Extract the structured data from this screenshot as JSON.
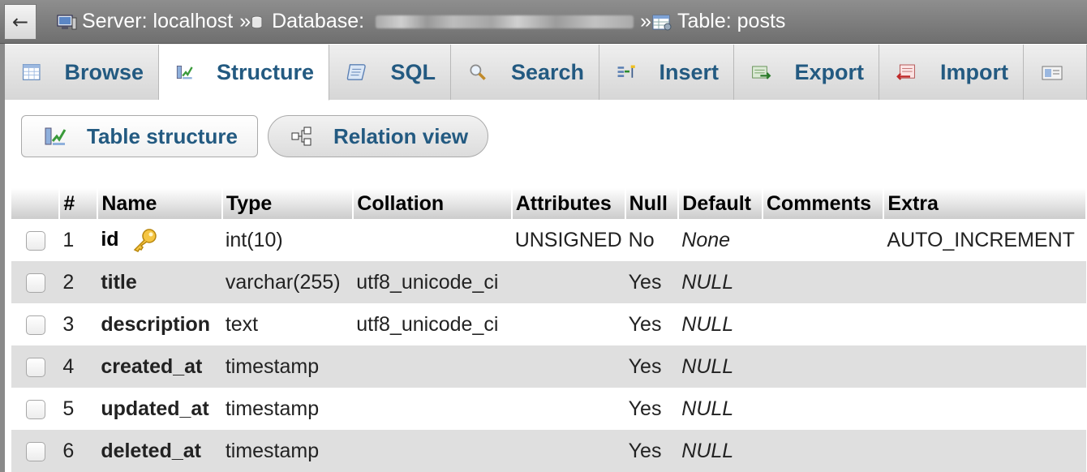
{
  "breadcrumb": {
    "back_icon": "←",
    "server": "Server: localhost",
    "database": "Database:",
    "table": "Table: posts",
    "separator": "»"
  },
  "tabs": [
    {
      "label": "Browse",
      "icon": "browse-icon"
    },
    {
      "label": "Structure",
      "icon": "structure-icon",
      "active": true
    },
    {
      "label": "SQL",
      "icon": "sql-icon"
    },
    {
      "label": "Search",
      "icon": "search-icon"
    },
    {
      "label": "Insert",
      "icon": "insert-icon"
    },
    {
      "label": "Export",
      "icon": "export-icon"
    },
    {
      "label": "Import",
      "icon": "import-icon"
    }
  ],
  "subviews": {
    "table_structure": "Table structure",
    "relation_view": "Relation view"
  },
  "columns": {
    "num": "#",
    "name": "Name",
    "type": "Type",
    "collation": "Collation",
    "attributes": "Attributes",
    "null": "Null",
    "default": "Default",
    "comments": "Comments",
    "extra": "Extra"
  },
  "rows": [
    {
      "num": "1",
      "name": "id",
      "type": "int(10)",
      "collation": "",
      "attributes": "UNSIGNED",
      "null": "No",
      "default": "None",
      "comments": "",
      "extra": "AUTO_INCREMENT"
    },
    {
      "num": "2",
      "name": "title",
      "type": "varchar(255)",
      "collation": "utf8_unicode_ci",
      "attributes": "",
      "null": "Yes",
      "default": "NULL",
      "comments": "",
      "extra": ""
    },
    {
      "num": "3",
      "name": "description",
      "type": "text",
      "collation": "utf8_unicode_ci",
      "attributes": "",
      "null": "Yes",
      "default": "NULL",
      "comments": "",
      "extra": ""
    },
    {
      "num": "4",
      "name": "created_at",
      "type": "timestamp",
      "collation": "",
      "attributes": "",
      "null": "Yes",
      "default": "NULL",
      "comments": "",
      "extra": ""
    },
    {
      "num": "5",
      "name": "updated_at",
      "type": "timestamp",
      "collation": "",
      "attributes": "",
      "null": "Yes",
      "default": "NULL",
      "comments": "",
      "extra": ""
    },
    {
      "num": "6",
      "name": "deleted_at",
      "type": "timestamp",
      "collation": "",
      "attributes": "",
      "null": "Yes",
      "default": "NULL",
      "comments": "",
      "extra": ""
    }
  ],
  "colors": {
    "link_blue": "#235a81",
    "row_alt": "#dfdfdf",
    "bar_grey": "#7f7f7f"
  }
}
